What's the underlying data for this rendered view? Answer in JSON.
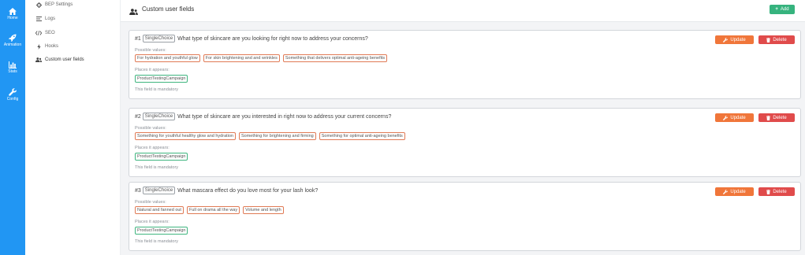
{
  "rail": {
    "items": [
      {
        "label": "Home",
        "icon": "home-icon"
      },
      {
        "label": "Animation",
        "icon": "rocket-icon"
      },
      {
        "label": "Stats",
        "icon": "bar-chart-icon"
      },
      {
        "label": "Config",
        "icon": "wrench-icon"
      }
    ]
  },
  "sidebar": {
    "items": [
      {
        "label": "BEP Settings",
        "icon": "gear-icon"
      },
      {
        "label": "Logs",
        "icon": "list-icon"
      },
      {
        "label": "SEO",
        "icon": "code-icon"
      },
      {
        "label": "Hooks",
        "icon": "bolt-icon"
      },
      {
        "label": "Custom user fields",
        "icon": "users-icon"
      }
    ],
    "active": "Custom user fields"
  },
  "header": {
    "title": "Custom user fields",
    "add_label": "Add"
  },
  "labels": {
    "possible_values": "Possible values:",
    "places": "Places it appears:",
    "mandatory": "This field is mandatory",
    "update": "Update",
    "delete": "Delete"
  },
  "fields": [
    {
      "number": "#1",
      "type": "SingleChoice",
      "question": "What type of skincare are you looking for right now to address your concerns?",
      "values": [
        "For hydration and youthful glow",
        "For skin brightening and and wrinkles",
        "Something that delivers optimal anti-ageing benefits"
      ],
      "places": [
        "ProductTestingCampaign"
      ]
    },
    {
      "number": "#2",
      "type": "SingleChoice",
      "question": "What type of skincare are you interested in right now to address your current concerns?",
      "values": [
        "Something for youthful healthy glow and hydration",
        "Something for brightening and firming",
        "Something for optimal anti-ageing benefits"
      ],
      "places": [
        "ProductTestingCampaign"
      ]
    },
    {
      "number": "#3",
      "type": "SingleChoice",
      "question": "What mascara effect do you love most for your lash look?",
      "values": [
        "Natural and fanned out",
        "Full on drama all the way",
        "Volume and length"
      ],
      "places": [
        "ProductTestingCampaign"
      ]
    }
  ],
  "colors": {
    "rail": "#2196f3",
    "add": "#36b37e",
    "update": "#f0763a",
    "delete": "#e04b4b",
    "value_border": "#e07a55",
    "place_border": "#3fb57f"
  }
}
